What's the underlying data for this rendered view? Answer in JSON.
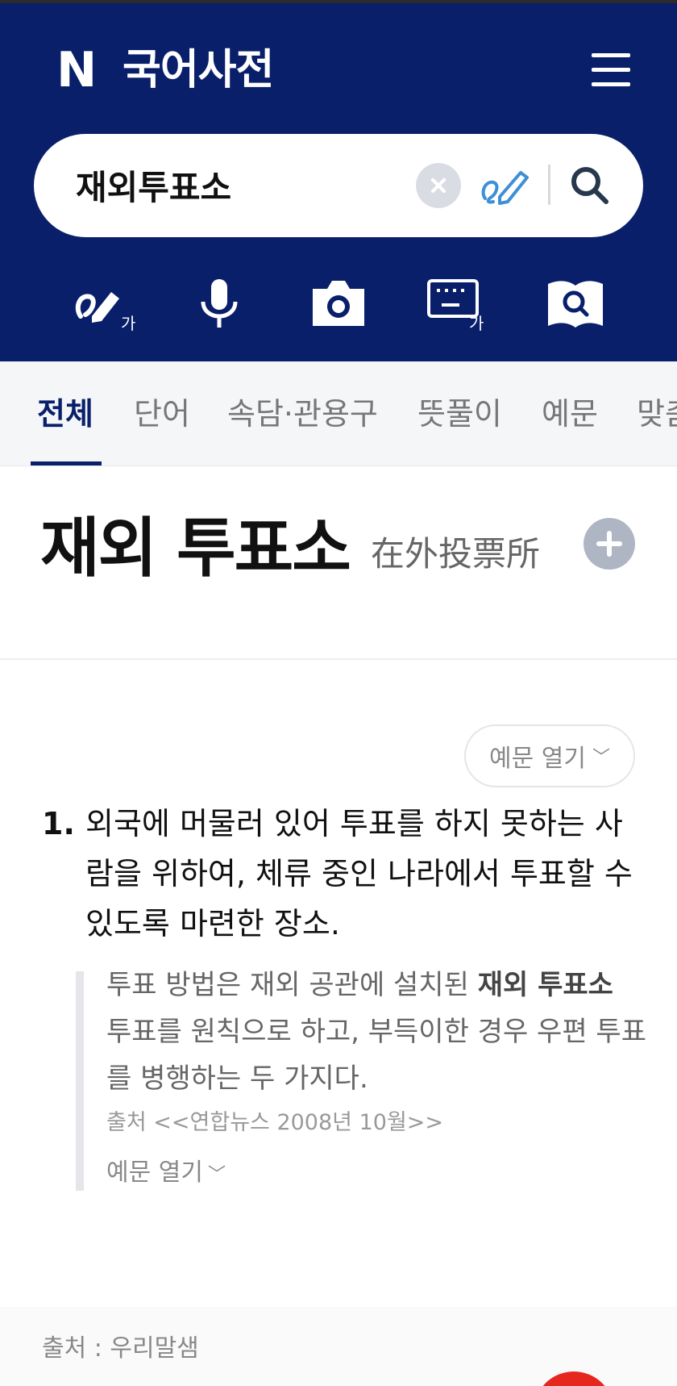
{
  "header": {
    "logo_letter": "N",
    "title": "국어사전",
    "search_value": "재외투표소",
    "colors": {
      "brand": "#0a1f6a",
      "fab": "#e5271f"
    },
    "icons": [
      "menu-icon",
      "clear-icon",
      "handwriting-icon",
      "search-icon"
    ]
  },
  "tools": [
    {
      "name": "handwriting-input-icon"
    },
    {
      "name": "microphone-icon"
    },
    {
      "name": "camera-icon"
    },
    {
      "name": "keyboard-icon"
    },
    {
      "name": "dictionary-search-icon"
    }
  ],
  "tabs": [
    {
      "label": "전체",
      "active": true
    },
    {
      "label": "단어"
    },
    {
      "label": "속담·관용구"
    },
    {
      "label": "뜻풀이"
    },
    {
      "label": "예문"
    },
    {
      "label": "맞춤"
    }
  ],
  "entry": {
    "word": "재외 투표소",
    "hanja": "在外投票所",
    "example_toggle": "예문 열기",
    "definitions": [
      {
        "number": "1.",
        "text": "외국에 머물러 있어 투표를 하지 못하는 사람을 위하여, 체류 중인 나라에서 투표할 수 있도록 마련한 장소.",
        "example": {
          "before": "투표 방법은 재외 공관에 설치된 ",
          "highlight": "재외 투표소",
          "after": " 투표를 원칙으로 하고, 부득이한 경우 우편 투표를 병행하는 두 가지다.",
          "source": "출처 <<연합뉴스 2008년 10월>>",
          "toggle": "예문 열기"
        }
      }
    ]
  },
  "footer": {
    "source": "출처 : 우리말샘"
  }
}
